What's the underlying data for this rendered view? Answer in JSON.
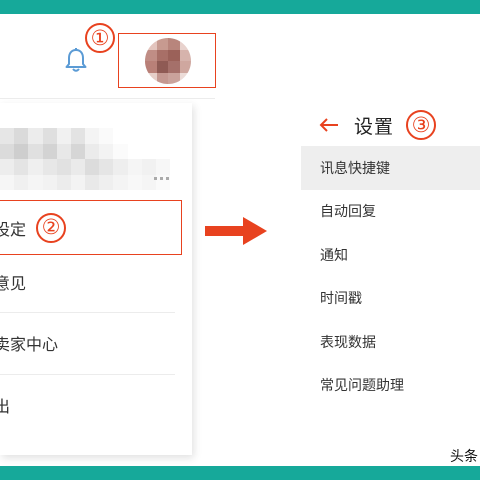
{
  "colors": {
    "accent_bar": "#16a99a",
    "highlight": "#e8421f"
  },
  "header": {
    "bell_icon": "bell-icon",
    "marker_1": "①"
  },
  "dropdown": {
    "items": [
      {
        "label": "设定",
        "marker": "②",
        "highlighted": true
      },
      {
        "label": "意见"
      },
      {
        "label": "卖家中心"
      },
      {
        "label": "出"
      }
    ]
  },
  "settings": {
    "back_icon": "arrow-left-icon",
    "title": "设置",
    "marker_3": "③",
    "items": [
      {
        "label": "讯息快捷键",
        "active": true
      },
      {
        "label": "自动回复"
      },
      {
        "label": "通知"
      },
      {
        "label": "时间戳"
      },
      {
        "label": "表现数据"
      },
      {
        "label": "常见问题助理"
      }
    ]
  },
  "watermark": "头条"
}
